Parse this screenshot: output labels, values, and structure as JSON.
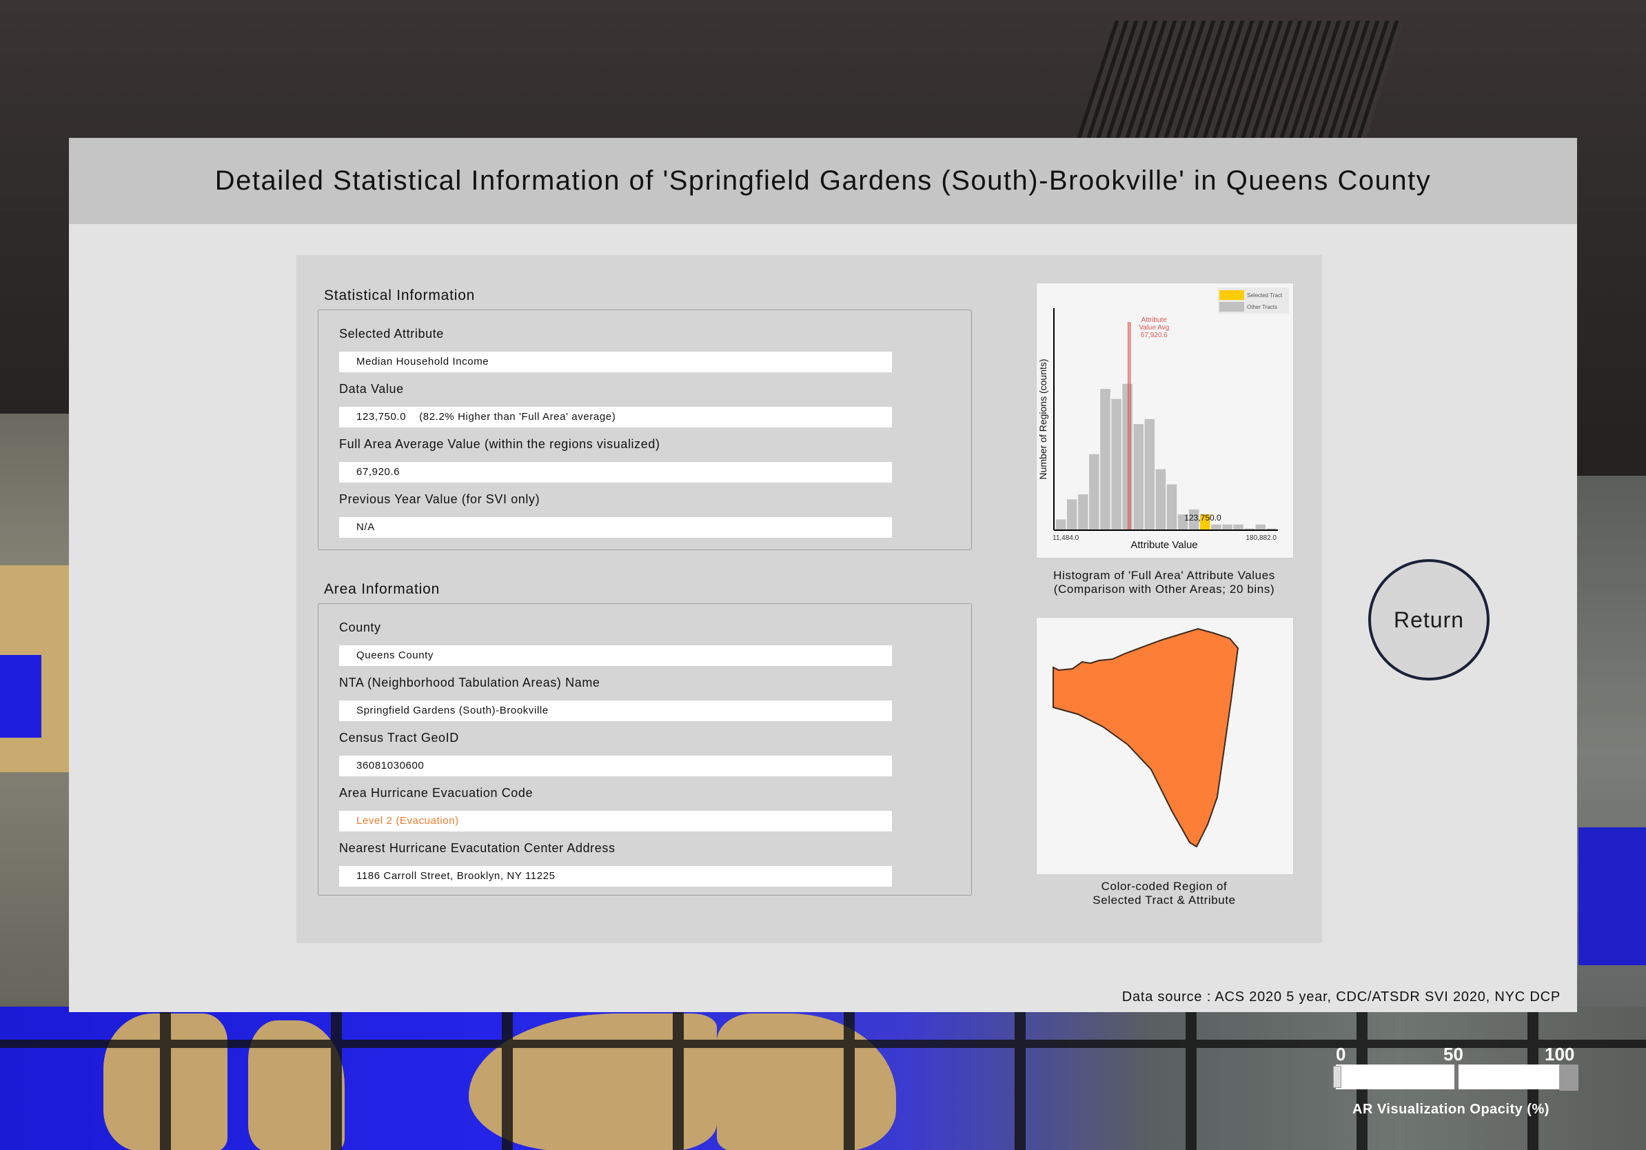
{
  "panel": {
    "title": "Detailed Statistical Information of 'Springfield Gardens (South)-Brookville' in Queens County",
    "source": "Data source : ACS 2020 5 year, CDC/ATSDR SVI 2020, NYC DCP"
  },
  "stats": {
    "section_title": "Statistical Information",
    "fields": [
      {
        "label": "Selected Attribute",
        "value": "Median Household Income"
      },
      {
        "label": "Data Value",
        "value": "123,750.0    (82.2% Higher than 'Full Area' average)"
      },
      {
        "label": "Full Area Average Value (within the regions visualized)",
        "value": "67,920.6"
      },
      {
        "label": "Previous Year Value (for SVI only)",
        "value": "N/A"
      }
    ]
  },
  "area": {
    "section_title": "Area Information",
    "fields": [
      {
        "label": "County",
        "value": "Queens County"
      },
      {
        "label": "NTA (Neighborhood Tabulation Areas) Name",
        "value": "Springfield Gardens (South)-Brookville"
      },
      {
        "label": "Census Tract GeoID",
        "value": "36081030600"
      },
      {
        "label": "Area Hurricane Evacuation Code",
        "value": "Level 2 (Evacuation)"
      },
      {
        "label": "Nearest Hurricane Evacutation Center Address",
        "value": "1186 Carroll Street, Brooklyn, NY 11225"
      }
    ]
  },
  "chart_data": {
    "type": "bar",
    "title": "",
    "xlabel": "Attribute Value",
    "ylabel": "Number of Regions (counts)",
    "x_min_label": "11,484.0",
    "x_max_label": "180,882.0",
    "x_range": [
      11484.0,
      180882.0
    ],
    "bins": 20,
    "counts": [
      2,
      6,
      7,
      15,
      28,
      26,
      29,
      21,
      22,
      12,
      9,
      3,
      4,
      3,
      1,
      1,
      1,
      0,
      1,
      0
    ],
    "selected_bin": 13,
    "selected_value": 123750.0,
    "selected_value_label": "123,750.0",
    "average_value": 67920.6,
    "average_label_lines": [
      "Attribute",
      "Value Avg",
      "67,920.6"
    ],
    "legend": [
      {
        "name": "Selected Tract",
        "color": "#ffcc00"
      },
      {
        "name": "Other Tracts",
        "color": "#c0c0c0"
      }
    ],
    "legend_position": "top-right",
    "bar_color": "#c0c0c0",
    "selected_color": "#ffcc00",
    "avg_line_color": "#e05656",
    "caption_lines": [
      "Histogram of 'Full Area' Attribute Values",
      "(Comparison with Other Areas; 20 bins)"
    ]
  },
  "region_map": {
    "fill_color": "#fd7e36",
    "caption_lines": [
      "Color-coded Region of",
      "Selected Tract & Attribute"
    ]
  },
  "return_label": "Return",
  "opacity_slider": {
    "ticks": [
      "0",
      "50",
      "100"
    ],
    "value_percent": 100,
    "label": "AR Visualization Opacity (%)"
  }
}
